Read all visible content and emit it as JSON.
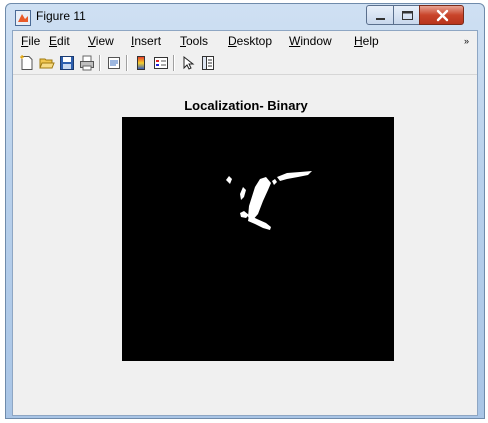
{
  "window": {
    "title": "Figure 11",
    "icon": "matlab-figure-icon"
  },
  "controls": {
    "minimize": "minimize-icon",
    "maximize": "maximize-icon",
    "close": "close-icon"
  },
  "menu": {
    "items": [
      {
        "key": "F",
        "rest": "ile"
      },
      {
        "key": "E",
        "rest": "dit"
      },
      {
        "key": "V",
        "rest": "iew"
      },
      {
        "key": "I",
        "rest": "nsert"
      },
      {
        "key": "T",
        "rest": "ools"
      },
      {
        "key": "D",
        "rest": "esktop"
      },
      {
        "key": "W",
        "rest": "indow"
      },
      {
        "key": "H",
        "rest": "elp"
      }
    ],
    "overflow": "»"
  },
  "toolbar": {
    "buttons": [
      "new-figure-icon",
      "open-file-icon",
      "save-icon",
      "print-icon",
      "print-preview-icon",
      "colorbar-icon",
      "legend-icon",
      "edit-plot-arrow-icon",
      "property-inspector-icon"
    ]
  },
  "figure": {
    "title": "Localization- Binary",
    "background": "#000000",
    "foreground": "#ffffff"
  }
}
